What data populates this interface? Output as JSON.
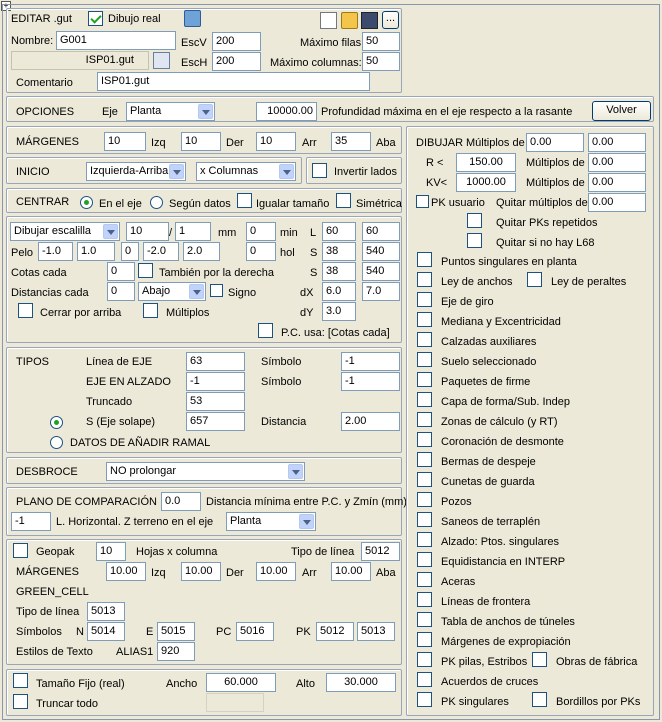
{
  "window_icon": "window-icon",
  "editar": {
    "title": "EDITAR .gut",
    "dibujo_real": "Dibujo real",
    "nombre_lbl": "Nombre:",
    "nombre": "G001",
    "file": "ISP01.gut",
    "escv_lbl": "EscV",
    "escv": "200",
    "esch_lbl": "EscH",
    "esch": "200",
    "maxfilas_lbl": "Máximo filas:",
    "maxfilas": "50",
    "maxcol_lbl": "Máximo columnas:",
    "maxcol": "50",
    "comentario_lbl": "Comentario",
    "comentario": "ISP01.gut",
    "more": "..."
  },
  "opciones": {
    "title": "OPCIONES",
    "eje_lbl": "Eje",
    "eje": "Planta",
    "prof": "10000.00",
    "prof_lbl": "Profundidad máxima en el eje respecto a la rasante",
    "volver": "Volver"
  },
  "margenes": {
    "title": "MÁRGENES",
    "izq_val": "10",
    "izq": "Izq",
    "der_val": "10",
    "der": "Der",
    "arr_val": "10",
    "arr": "Arr",
    "aba_val": "35",
    "aba": "Aba"
  },
  "inicio": {
    "title": "INICIO",
    "pos": "Izquierda-Arriba",
    "order": "x Columnas",
    "invertir": "Invertir lados"
  },
  "centrar": {
    "title": "CENTRAR",
    "en_eje": "En el eje",
    "segun": "Según datos",
    "igualar": "Igualar tamaño",
    "simetrica": "Simétrica"
  },
  "escalilla": {
    "dibujar": "Dibujar escalilla",
    "v1": "10",
    "slash": "/",
    "v2": "1",
    "mm": "mm",
    "v3": "0",
    "min": "min",
    "L_lbl": "L",
    "L1": "60",
    "L2": "60",
    "pelo": "Pelo",
    "p1": "-1.0",
    "p2": "1.0",
    "p3": "0",
    "p4": "-2.0",
    "p5": "2.0",
    "p6": "0",
    "hol": "hol",
    "S_lbl": "S",
    "S1": "38",
    "S2": "540",
    "cotas": "Cotas cada",
    "cotas_val": "0",
    "derecha": "También por la derecha",
    "S3": "38",
    "S4": "540",
    "dist": "Distancias cada",
    "dist_val": "0",
    "abajo": "Abajo",
    "signo": "Signo",
    "dX_lbl": "dX",
    "dX1": "6.0",
    "dX2": "7.0",
    "cerrar": "Cerrar por arriba",
    "multiplos": "Múltiplos",
    "dY_lbl": "dY",
    "dY": "3.0",
    "pc_usa": "P.C. usa: [Cotas cada]"
  },
  "tipos": {
    "title": "TIPOS",
    "linea_eje": "Línea de EJE",
    "linea_eje_val": "63",
    "simbolo": "Símbolo",
    "sim1": "-1",
    "eje_alzado": "EJE EN ALZADO",
    "eje_alzado_val": "-1",
    "sim2": "-1",
    "truncado": "Truncado",
    "truncado_val": "53",
    "s_eje": "S (Eje solape)",
    "s_eje_val": "657",
    "distancia": "Distancia",
    "distancia_val": "2.00",
    "ramal": "DATOS DE AÑADIR RAMAL"
  },
  "desbroce": {
    "title": "DESBROCE",
    "value": "NO prolongar"
  },
  "plano": {
    "title": "PLANO DE COMPARACIÓN",
    "val": "0.0",
    "dist_lbl": "Distancia mínima entre P.C. y Zmín (mm)",
    "lh_val": "-1",
    "lh_lbl": "L. Horizontal. Z terreno en el eje",
    "lh_sel": "Planta"
  },
  "geopak": {
    "geopak": "Geopak",
    "hojas_val": "10",
    "hojas": "Hojas x columna",
    "tipo_lbl": "Tipo de línea",
    "tipo_val": "5012",
    "margenes": "MÁRGENES",
    "izq_val": "10.00",
    "izq": "Izq",
    "der_val": "10.00",
    "der": "Der",
    "arr_val": "10.00",
    "arr": "Arr",
    "aba_val": "10.00",
    "aba": "Aba",
    "green": "GREEN_CELL",
    "tipo2_lbl": "Tipo de línea",
    "tipo2_val": "5013",
    "simbolos": "Símbolos",
    "N": "N",
    "N_val": "5014",
    "E": "E",
    "E_val": "5015",
    "PC": "PC",
    "PC_val": "5016",
    "PK": "PK",
    "PK_val1": "5012",
    "PK_val2": "5013",
    "estilos": "Estilos de Texto",
    "alias": "ALIAS1",
    "alias_val": "920"
  },
  "tamano": {
    "fijo": "Tamaño Fijo (real)",
    "ancho": "Ancho",
    "ancho_val": "60.000",
    "alto": "Alto",
    "alto_val": "30.000",
    "truncar": "Truncar todo"
  },
  "dibujar": {
    "title": "DIBUJAR",
    "multiplos_de": "Múltiplos de",
    "m1": "0.00",
    "m2": "0.00",
    "r_lbl": "R <",
    "r_val": "150.00",
    "m3": "0.00",
    "kv_lbl": "KV<",
    "kv_val": "1000.00",
    "m4": "0.00",
    "pk_usuario": "PK usuario",
    "quitar_mult": "Quitar múltiplos de",
    "m5": "0.00",
    "quitar_rep": "Quitar PKs repetidos",
    "quitar_l68": "Quitar si no hay L68"
  },
  "checklist": [
    {
      "label": "Puntos singulares en planta"
    },
    {
      "label": "Ley de anchos",
      "extra": "Ley de peraltes"
    },
    {
      "label": "Eje de giro"
    },
    {
      "label": "Mediana y Excentricidad"
    },
    {
      "label": "Calzadas auxiliares"
    },
    {
      "label": "Suelo seleccionado"
    },
    {
      "label": "Paquetes de firme"
    },
    {
      "label": "Capa de forma/Sub. Indep"
    },
    {
      "label": "Zonas de cálculo (y RT)"
    },
    {
      "label": "Coronación de desmonte"
    },
    {
      "label": "Bermas de despeje"
    },
    {
      "label": "Cunetas de guarda"
    },
    {
      "label": "Pozos"
    },
    {
      "label": "Saneos de terraplén"
    },
    {
      "label": "Alzado: Ptos. singulares"
    },
    {
      "label": "Equidistancia en INTERP"
    },
    {
      "label": "Aceras"
    },
    {
      "label": "Líneas de frontera"
    },
    {
      "label": "Tabla de anchos de túneles"
    },
    {
      "label": "Márgenes de expropiación"
    },
    {
      "label": "PK pilas, Estribos",
      "extra": "Obras de fábrica"
    },
    {
      "label": "Acuerdos de cruces"
    },
    {
      "label": "PK singulares",
      "extra": "Bordillos por PKs"
    }
  ]
}
